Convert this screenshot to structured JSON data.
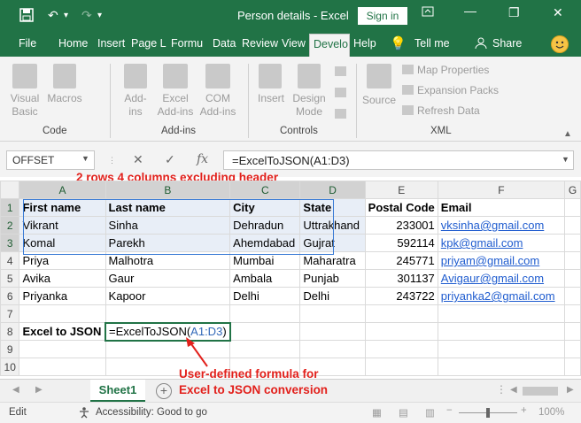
{
  "titlebar": {
    "title": "Person details  -  Excel",
    "signin_label": "Sign in",
    "save_icon": "save-icon",
    "undo_icon": "undo-icon",
    "redo_icon": "redo-icon",
    "customize_icon": "customize-qat-icon"
  },
  "tabs": [
    "File",
    "Home",
    "Insert",
    "Page L",
    "Formu",
    "Data",
    "Review",
    "View",
    "Develo",
    "Help"
  ],
  "tell_me": "Tell me",
  "share": "Share",
  "ribbon": {
    "code": {
      "label": "Code",
      "visual_basic_1": "Visual",
      "visual_basic_2": "Basic",
      "macros": "Macros"
    },
    "addins": {
      "label": "Add-ins",
      "addins_1": "Add-",
      "addins_2": "ins",
      "excel_addins_1": "Excel",
      "excel_addins_2": "Add-ins",
      "com_addins_1": "COM",
      "com_addins_2": "Add-ins"
    },
    "controls": {
      "label": "Controls",
      "insert": "Insert",
      "design_mode_1": "Design",
      "design_mode_2": "Mode"
    },
    "xml": {
      "label": "XML",
      "source": "Source",
      "map_properties": "Map Properties",
      "expansion_packs": "Expansion Packs",
      "refresh_data": "Refresh Data"
    }
  },
  "formula_bar": {
    "name_box": "OFFSET",
    "cancel_icon": "✕",
    "enter_icon": "✓",
    "fx": "fx",
    "formula": "=ExcelToJSON(A1:D3)"
  },
  "annotations": {
    "top": "2 rows 4 columns excluding header",
    "bottom_1": "User-defined formula for",
    "bottom_2": "Excel to JSON conversion"
  },
  "columns": [
    "A",
    "B",
    "C",
    "D",
    "E",
    "F",
    "G"
  ],
  "rows": [
    [
      "First name",
      "Last name",
      "City",
      "State",
      "Postal Code",
      "Email"
    ],
    [
      "Vikrant",
      "Sinha",
      "Dehradun",
      "Uttrakhand",
      "233001",
      "vksinha@gmail.com"
    ],
    [
      "Komal",
      "Parekh",
      "Ahemdabad",
      "Gujrat",
      "592114",
      "kpk@gmail.com"
    ],
    [
      "Priya",
      "Malhotra",
      "Mumbai",
      "Maharatra",
      "245771",
      "priyam@gmail.com"
    ],
    [
      "Avika",
      "Gaur",
      "Ambala",
      "Punjab",
      "301137",
      "Avigaur@gmail.com"
    ],
    [
      "Priyanka",
      "Kapoor",
      "Delhi",
      "Delhi",
      "243722",
      "priyanka2@gmail.com"
    ]
  ],
  "row8": {
    "label": "Excel to JSON",
    "formula_prefix": "=ExcelToJSON(",
    "formula_ref": "A1:D3",
    "formula_suffix": ")"
  },
  "sheet_tab": "Sheet1",
  "status": {
    "mode": "Edit",
    "accessibility": "Accessibility: Good to go",
    "zoom": "100%"
  },
  "colors": {
    "accent": "#217346",
    "annotation": "#e2211c",
    "link": "#1f5ccf",
    "selection": "#e8eef7"
  }
}
